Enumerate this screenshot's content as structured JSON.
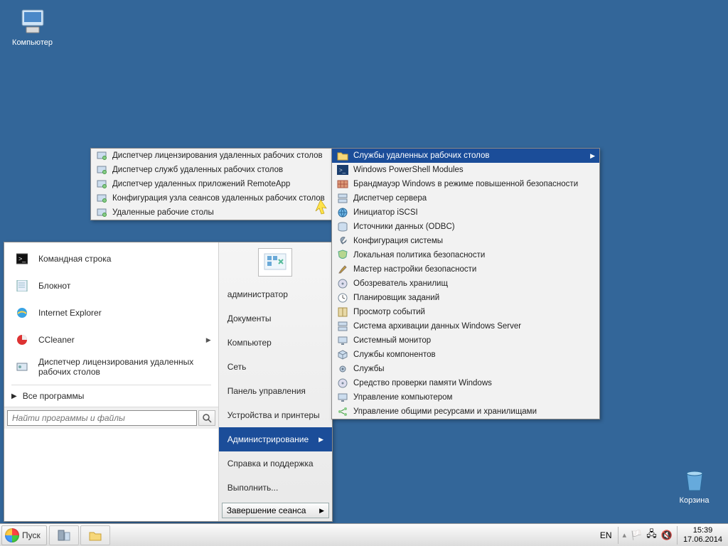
{
  "desktop": {
    "computer": "Компьютер",
    "recycle": "Корзина"
  },
  "start": {
    "apps": [
      {
        "label": "Командная строка",
        "icon": "cmd"
      },
      {
        "label": "Блокнот",
        "icon": "notepad"
      },
      {
        "label": "Internet Explorer",
        "icon": "ie"
      },
      {
        "label": "CCleaner",
        "icon": "ccleaner",
        "arrow": true
      },
      {
        "label": "Диспетчер лицензирования удаленных рабочих столов",
        "icon": "license"
      }
    ],
    "all_programs": "Все программы",
    "search_placeholder": "Найти программы и файлы",
    "right": {
      "user": "администратор",
      "documents": "Документы",
      "computer": "Компьютер",
      "network": "Сеть",
      "control_panel": "Панель управления",
      "devices": "Устройства и принтеры",
      "administration": "Администрирование",
      "help": "Справка и поддержка",
      "run": "Выполнить..."
    },
    "session": "Завершение сеанса"
  },
  "submenu1": [
    "Диспетчер лицензирования удаленных рабочих столов",
    "Диспетчер служб удаленных рабочих столов",
    "Диспетчер удаленных приложений RemoteApp",
    "Конфигурация узла сеансов удаленных рабочих столов",
    "Удаленные рабочие столы"
  ],
  "submenu2": [
    {
      "label": "Службы удаленных рабочих столов",
      "hl": true,
      "arrow": true
    },
    {
      "label": "Windows PowerShell Modules"
    },
    {
      "label": "Брандмауэр Windows в режиме повышенной безопасности"
    },
    {
      "label": "Диспетчер сервера"
    },
    {
      "label": "Инициатор iSCSI"
    },
    {
      "label": "Источники данных (ODBC)"
    },
    {
      "label": "Конфигурация системы"
    },
    {
      "label": "Локальная политика безопасности"
    },
    {
      "label": "Мастер настройки безопасности"
    },
    {
      "label": "Обозреватель хранилищ"
    },
    {
      "label": "Планировщик заданий"
    },
    {
      "label": "Просмотр событий"
    },
    {
      "label": "Система архивации данных Windows Server"
    },
    {
      "label": "Системный монитор"
    },
    {
      "label": "Службы компонентов"
    },
    {
      "label": "Службы"
    },
    {
      "label": "Средство проверки памяти Windows"
    },
    {
      "label": "Управление компьютером"
    },
    {
      "label": "Управление общими ресурсами и хранилищами"
    }
  ],
  "taskbar": {
    "start_label": "Пуск",
    "lang": "EN",
    "time": "15:39",
    "date": "17.06.2014"
  }
}
